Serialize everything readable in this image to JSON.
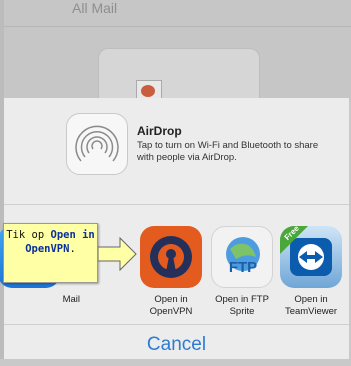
{
  "background": {
    "title": "All Mail"
  },
  "airdrop": {
    "title": "AirDrop",
    "description": "Tap to turn on Wi-Fi and Bluetooth to share with people via AirDrop."
  },
  "apps": [
    {
      "label": "Mail"
    },
    {
      "label": "Open in OpenVPN"
    },
    {
      "label": "Open in FTP Sprite"
    },
    {
      "label": "Open in TeamViewer"
    }
  ],
  "ftp_icon_text": "FTP",
  "free_badge": "Free",
  "cancel": "Cancel",
  "callout": {
    "prefix": "Tik op ",
    "target": "Open in OpenVPN",
    "suffix": "."
  },
  "colors": {
    "accent": "#2d7bd4",
    "callout_bg": "#ffffa6",
    "openvpn_orange": "#e35b1e",
    "openvpn_navy": "#24305a"
  },
  "icons": [
    "airdrop-icon",
    "mail-icon",
    "openvpn-icon",
    "ftp-sprite-icon",
    "teamviewer-icon",
    "arrow-icon"
  ]
}
